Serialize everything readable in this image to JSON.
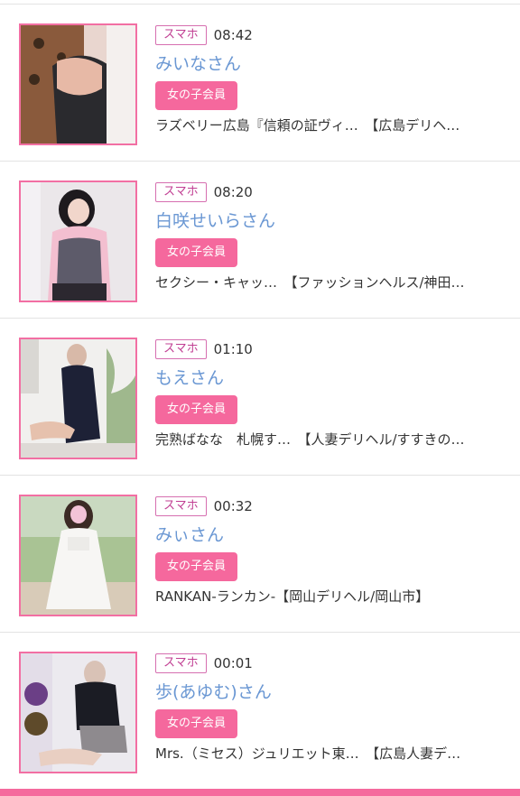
{
  "items": [
    {
      "device": "スマホ",
      "time": "08:42",
      "name": "みいなさん",
      "member": "女の子会員",
      "shop": "ラズベリー広島『信頼の証ヴィ…　【広島デリヘ…"
    },
    {
      "device": "スマホ",
      "time": "08:20",
      "name": "白咲せいらさん",
      "member": "女の子会員",
      "shop": "セクシー・キャッ…　【ファッションヘルス/神田…"
    },
    {
      "device": "スマホ",
      "time": "01:10",
      "name": "もえさん",
      "member": "女の子会員",
      "shop": "完熟ばなな　札幌す…　【人妻デリヘル/すすきの…"
    },
    {
      "device": "スマホ",
      "time": "00:32",
      "name": "みぃさん",
      "member": "女の子会員",
      "shop": "RANKAN-ランカン-【岡山デリヘル/岡山市】"
    },
    {
      "device": "スマホ",
      "time": "00:01",
      "name": "歩(あゆむ)さん",
      "member": "女の子会員",
      "shop": "Mrs.（ミセス）ジュリエット東…　【広島人妻デ…"
    }
  ],
  "theme": {
    "accent": "#f5689d",
    "name_color": "#6a97d3",
    "badge_border": "#d66fb0"
  }
}
